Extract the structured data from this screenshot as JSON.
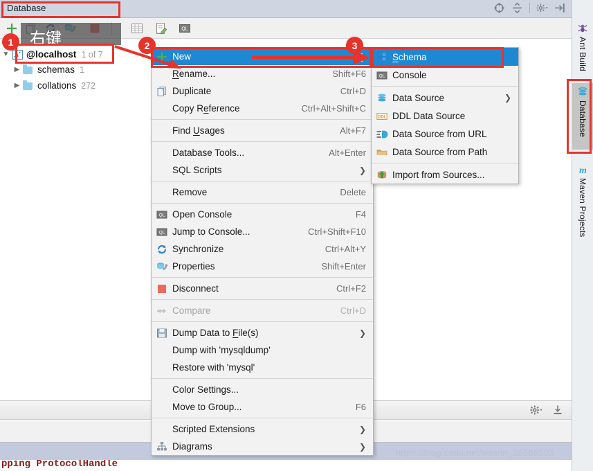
{
  "window": {
    "title": "Database",
    "header_icons": [
      "crosshair-target-icon",
      "collapse-all-icon",
      "settings-gear-icon",
      "hide-panel-icon"
    ]
  },
  "toolbar": {
    "buttons": [
      {
        "name": "add-new-icon",
        "label": "+"
      },
      {
        "name": "copy-data-source-icon",
        "label": ""
      },
      {
        "name": "refresh-synchronize-icon",
        "label": ""
      },
      {
        "name": "properties-wrench-icon",
        "label": ""
      },
      {
        "name": "stop-disconnect-icon",
        "label": ""
      },
      {
        "name": "table-editor-icon",
        "label": ""
      },
      {
        "name": "modify-table-icon",
        "label": ""
      },
      {
        "name": "open-console-icon",
        "label": "QL"
      }
    ]
  },
  "tree": {
    "items": [
      {
        "label": "@localhost",
        "sub": "1 of 7",
        "icon": "mysql-datasource-icon",
        "bold": true,
        "expanded": true,
        "indent": 0
      },
      {
        "label": "schemas",
        "sub": "1",
        "icon": "folder-icon",
        "bold": false,
        "expanded": false,
        "indent": 1
      },
      {
        "label": "collations",
        "sub": "272",
        "icon": "folder-icon",
        "bold": false,
        "expanded": false,
        "indent": 1
      }
    ]
  },
  "context_menu": {
    "groups": [
      [
        {
          "label": "New",
          "shortcut": "",
          "arrow": true,
          "icon": "plus-icon",
          "selected": true,
          "disabled": false,
          "mnemonic": -1
        },
        {
          "label": "Rename...",
          "shortcut": "Shift+F6",
          "arrow": false,
          "icon": "",
          "selected": false,
          "disabled": false,
          "mnemonic": 0
        },
        {
          "label": "Duplicate",
          "shortcut": "Ctrl+D",
          "arrow": false,
          "icon": "duplicate-pages-icon",
          "selected": false,
          "disabled": false,
          "mnemonic": -1
        },
        {
          "label": "Copy Reference",
          "shortcut": "Ctrl+Alt+Shift+C",
          "arrow": false,
          "icon": "",
          "selected": false,
          "disabled": false,
          "mnemonic": 6
        }
      ],
      [
        {
          "label": "Find Usages",
          "shortcut": "Alt+F7",
          "arrow": false,
          "icon": "",
          "selected": false,
          "disabled": false,
          "mnemonic": 5
        }
      ],
      [
        {
          "label": "Database Tools...",
          "shortcut": "Alt+Enter",
          "arrow": false,
          "icon": "",
          "selected": false,
          "disabled": false,
          "mnemonic": -1
        },
        {
          "label": "SQL Scripts",
          "shortcut": "",
          "arrow": true,
          "icon": "",
          "selected": false,
          "disabled": false,
          "mnemonic": -1
        }
      ],
      [
        {
          "label": "Remove",
          "shortcut": "Delete",
          "arrow": false,
          "icon": "",
          "selected": false,
          "disabled": false,
          "mnemonic": -1
        }
      ],
      [
        {
          "label": "Open Console",
          "shortcut": "F4",
          "arrow": false,
          "icon": "sql-console-icon",
          "selected": false,
          "disabled": false,
          "mnemonic": -1
        },
        {
          "label": "Jump to Console...",
          "shortcut": "Ctrl+Shift+F10",
          "arrow": false,
          "icon": "sql-console-icon",
          "selected": false,
          "disabled": false,
          "mnemonic": -1
        },
        {
          "label": "Synchronize",
          "shortcut": "Ctrl+Alt+Y",
          "arrow": false,
          "icon": "synchronize-icon",
          "selected": false,
          "disabled": false,
          "mnemonic": -1
        },
        {
          "label": "Properties",
          "shortcut": "Shift+Enter",
          "arrow": false,
          "icon": "properties-wrench-icon",
          "selected": false,
          "disabled": false,
          "mnemonic": -1
        }
      ],
      [
        {
          "label": "Disconnect",
          "shortcut": "Ctrl+F2",
          "arrow": false,
          "icon": "disconnect-stop-icon",
          "selected": false,
          "disabled": false,
          "mnemonic": -1
        }
      ],
      [
        {
          "label": "Compare",
          "shortcut": "Ctrl+D",
          "arrow": false,
          "icon": "compare-icon",
          "selected": false,
          "disabled": true,
          "mnemonic": -1
        }
      ],
      [
        {
          "label": "Dump Data to File(s)",
          "shortcut": "",
          "arrow": true,
          "icon": "save-floppy-icon",
          "selected": false,
          "disabled": false,
          "mnemonic": 13
        },
        {
          "label": "Dump with 'mysqldump'",
          "shortcut": "",
          "arrow": false,
          "icon": "",
          "selected": false,
          "disabled": false,
          "mnemonic": -1
        },
        {
          "label": "Restore with 'mysql'",
          "shortcut": "",
          "arrow": false,
          "icon": "",
          "selected": false,
          "disabled": false,
          "mnemonic": -1
        }
      ],
      [
        {
          "label": "Color Settings...",
          "shortcut": "",
          "arrow": false,
          "icon": "",
          "selected": false,
          "disabled": false,
          "mnemonic": -1
        },
        {
          "label": "Move to Group...",
          "shortcut": "F6",
          "arrow": false,
          "icon": "",
          "selected": false,
          "disabled": false,
          "mnemonic": -1
        }
      ],
      [
        {
          "label": "Scripted Extensions",
          "shortcut": "",
          "arrow": true,
          "icon": "",
          "selected": false,
          "disabled": false,
          "mnemonic": -1
        },
        {
          "label": "Diagrams",
          "shortcut": "",
          "arrow": true,
          "icon": "diagram-icon",
          "selected": false,
          "disabled": false,
          "mnemonic": -1
        }
      ]
    ]
  },
  "sub_menu": {
    "groups": [
      [
        {
          "label": "Schema",
          "arrow": false,
          "icon": "schema-icon",
          "selected": true,
          "mnemonic": 0
        },
        {
          "label": "Console",
          "arrow": false,
          "icon": "sql-console-icon",
          "selected": false,
          "mnemonic": -1
        }
      ],
      [
        {
          "label": "Data Source",
          "arrow": true,
          "icon": "database-stack-icon",
          "selected": false,
          "mnemonic": -1
        },
        {
          "label": "DDL Data Source",
          "arrow": false,
          "icon": "ddl-icon",
          "selected": false,
          "mnemonic": -1
        },
        {
          "label": "Data Source from URL",
          "arrow": false,
          "icon": "url-datasource-icon",
          "selected": false,
          "mnemonic": -1
        },
        {
          "label": "Data Source from Path",
          "arrow": false,
          "icon": "folder-open-icon",
          "selected": false,
          "mnemonic": -1
        }
      ],
      [
        {
          "label": "Import from Sources...",
          "arrow": false,
          "icon": "import-icon",
          "selected": false,
          "mnemonic": -1
        }
      ]
    ]
  },
  "right_stripe": {
    "buttons": [
      {
        "label": "Ant Build",
        "icon": "ant-icon",
        "active": false
      },
      {
        "label": "Database",
        "icon": "database-stack-icon",
        "active": true
      },
      {
        "label": "Maven Projects",
        "icon": "maven-m-icon",
        "active": false
      }
    ]
  },
  "bottom": {
    "icons": [
      "settings-gear-icon",
      "export-download-icon"
    ],
    "console_text": "pping ProtocolHandle"
  },
  "annotations": {
    "callouts": [
      {
        "number": "1",
        "target": "localhost-tree-node"
      },
      {
        "number": "2",
        "target": "new-menu-item"
      },
      {
        "number": "3",
        "target": "schema-submenu-item"
      }
    ],
    "chinese_hint": "右键",
    "watermark": "https://blog.csdn.net/weixin_38568503",
    "box_color": "#e8332a"
  }
}
